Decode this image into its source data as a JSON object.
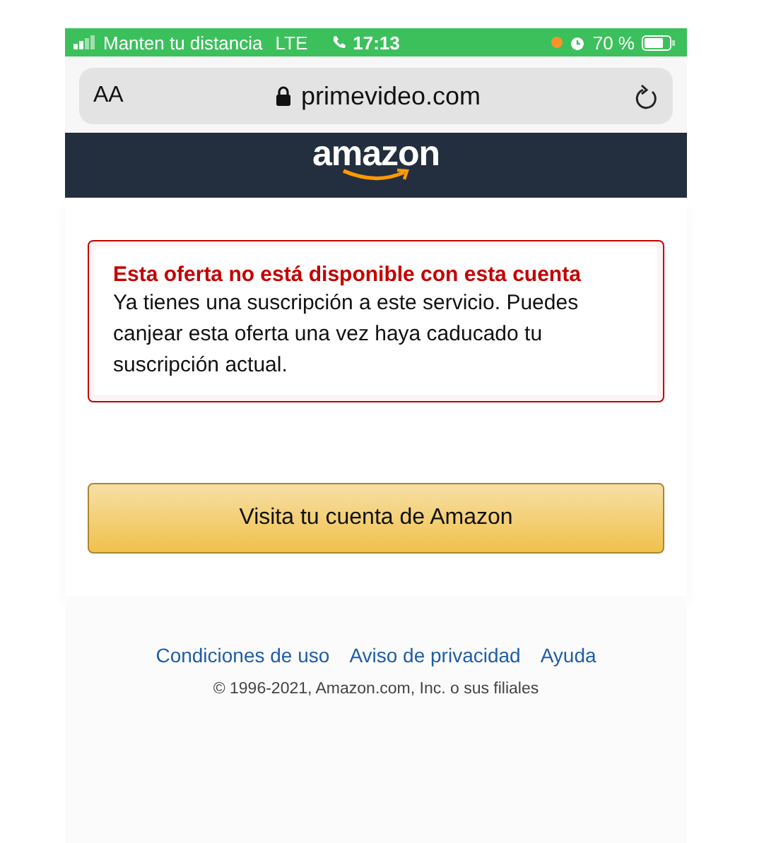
{
  "status_bar": {
    "carrier": "Manten tu distancia",
    "network": "LTE",
    "time": "17:13",
    "battery": "70 %",
    "recording_dot": true
  },
  "address_bar": {
    "text_size_button": "AA",
    "url": "primevideo.com"
  },
  "header": {
    "logo": "amazon"
  },
  "alert": {
    "title": "Esta oferta no está disponible con esta cuenta",
    "message": "Ya tienes una suscripción a este servicio. Puedes canjear esta oferta una vez haya caducado tu suscripción actual."
  },
  "primary_button": "Visita tu cuenta de Amazon",
  "footer": {
    "links": [
      "Condiciones de uso",
      "Aviso de privacidad",
      "Ayuda"
    ],
    "copyright": "© 1996-2021, Amazon.com, Inc. o sus filiales"
  }
}
